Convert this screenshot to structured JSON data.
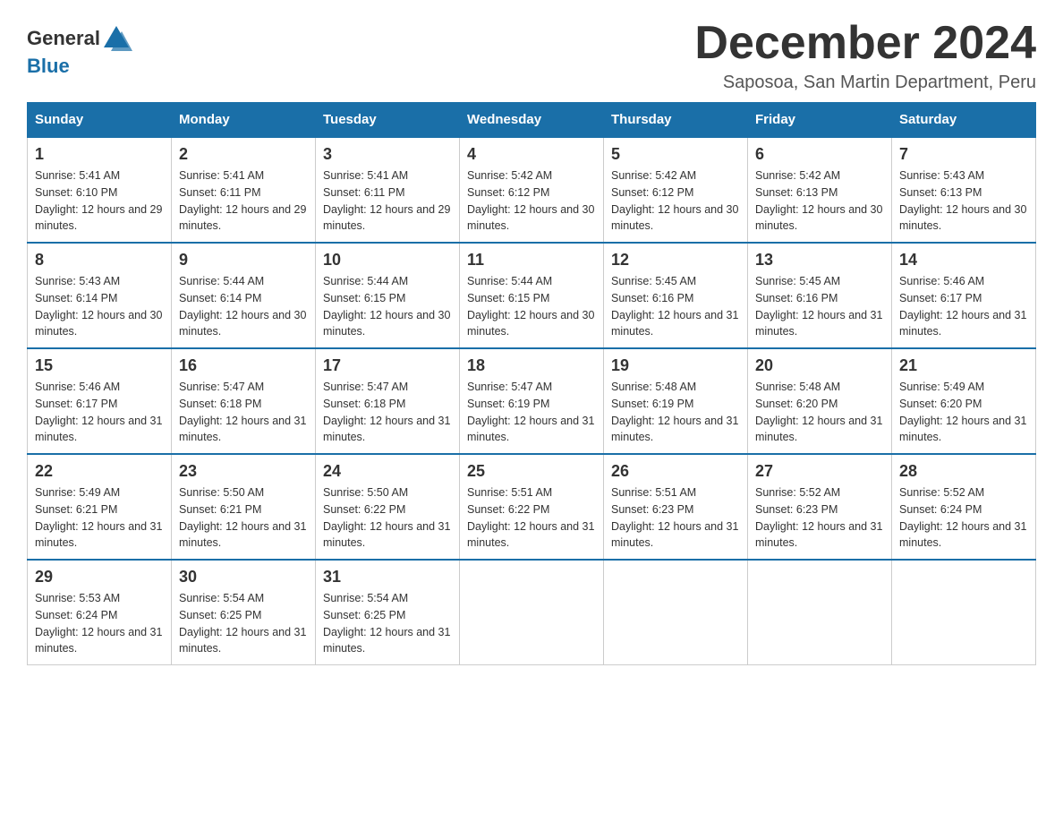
{
  "logo": {
    "general": "General",
    "blue": "Blue"
  },
  "title": "December 2024",
  "subtitle": "Saposoa, San Martin Department, Peru",
  "days": [
    "Sunday",
    "Monday",
    "Tuesday",
    "Wednesday",
    "Thursday",
    "Friday",
    "Saturday"
  ],
  "weeks": [
    [
      {
        "num": "1",
        "sunrise": "5:41 AM",
        "sunset": "6:10 PM",
        "daylight": "12 hours and 29 minutes."
      },
      {
        "num": "2",
        "sunrise": "5:41 AM",
        "sunset": "6:11 PM",
        "daylight": "12 hours and 29 minutes."
      },
      {
        "num": "3",
        "sunrise": "5:41 AM",
        "sunset": "6:11 PM",
        "daylight": "12 hours and 29 minutes."
      },
      {
        "num": "4",
        "sunrise": "5:42 AM",
        "sunset": "6:12 PM",
        "daylight": "12 hours and 30 minutes."
      },
      {
        "num": "5",
        "sunrise": "5:42 AM",
        "sunset": "6:12 PM",
        "daylight": "12 hours and 30 minutes."
      },
      {
        "num": "6",
        "sunrise": "5:42 AM",
        "sunset": "6:13 PM",
        "daylight": "12 hours and 30 minutes."
      },
      {
        "num": "7",
        "sunrise": "5:43 AM",
        "sunset": "6:13 PM",
        "daylight": "12 hours and 30 minutes."
      }
    ],
    [
      {
        "num": "8",
        "sunrise": "5:43 AM",
        "sunset": "6:14 PM",
        "daylight": "12 hours and 30 minutes."
      },
      {
        "num": "9",
        "sunrise": "5:44 AM",
        "sunset": "6:14 PM",
        "daylight": "12 hours and 30 minutes."
      },
      {
        "num": "10",
        "sunrise": "5:44 AM",
        "sunset": "6:15 PM",
        "daylight": "12 hours and 30 minutes."
      },
      {
        "num": "11",
        "sunrise": "5:44 AM",
        "sunset": "6:15 PM",
        "daylight": "12 hours and 30 minutes."
      },
      {
        "num": "12",
        "sunrise": "5:45 AM",
        "sunset": "6:16 PM",
        "daylight": "12 hours and 31 minutes."
      },
      {
        "num": "13",
        "sunrise": "5:45 AM",
        "sunset": "6:16 PM",
        "daylight": "12 hours and 31 minutes."
      },
      {
        "num": "14",
        "sunrise": "5:46 AM",
        "sunset": "6:17 PM",
        "daylight": "12 hours and 31 minutes."
      }
    ],
    [
      {
        "num": "15",
        "sunrise": "5:46 AM",
        "sunset": "6:17 PM",
        "daylight": "12 hours and 31 minutes."
      },
      {
        "num": "16",
        "sunrise": "5:47 AM",
        "sunset": "6:18 PM",
        "daylight": "12 hours and 31 minutes."
      },
      {
        "num": "17",
        "sunrise": "5:47 AM",
        "sunset": "6:18 PM",
        "daylight": "12 hours and 31 minutes."
      },
      {
        "num": "18",
        "sunrise": "5:47 AM",
        "sunset": "6:19 PM",
        "daylight": "12 hours and 31 minutes."
      },
      {
        "num": "19",
        "sunrise": "5:48 AM",
        "sunset": "6:19 PM",
        "daylight": "12 hours and 31 minutes."
      },
      {
        "num": "20",
        "sunrise": "5:48 AM",
        "sunset": "6:20 PM",
        "daylight": "12 hours and 31 minutes."
      },
      {
        "num": "21",
        "sunrise": "5:49 AM",
        "sunset": "6:20 PM",
        "daylight": "12 hours and 31 minutes."
      }
    ],
    [
      {
        "num": "22",
        "sunrise": "5:49 AM",
        "sunset": "6:21 PM",
        "daylight": "12 hours and 31 minutes."
      },
      {
        "num": "23",
        "sunrise": "5:50 AM",
        "sunset": "6:21 PM",
        "daylight": "12 hours and 31 minutes."
      },
      {
        "num": "24",
        "sunrise": "5:50 AM",
        "sunset": "6:22 PM",
        "daylight": "12 hours and 31 minutes."
      },
      {
        "num": "25",
        "sunrise": "5:51 AM",
        "sunset": "6:22 PM",
        "daylight": "12 hours and 31 minutes."
      },
      {
        "num": "26",
        "sunrise": "5:51 AM",
        "sunset": "6:23 PM",
        "daylight": "12 hours and 31 minutes."
      },
      {
        "num": "27",
        "sunrise": "5:52 AM",
        "sunset": "6:23 PM",
        "daylight": "12 hours and 31 minutes."
      },
      {
        "num": "28",
        "sunrise": "5:52 AM",
        "sunset": "6:24 PM",
        "daylight": "12 hours and 31 minutes."
      }
    ],
    [
      {
        "num": "29",
        "sunrise": "5:53 AM",
        "sunset": "6:24 PM",
        "daylight": "12 hours and 31 minutes."
      },
      {
        "num": "30",
        "sunrise": "5:54 AM",
        "sunset": "6:25 PM",
        "daylight": "12 hours and 31 minutes."
      },
      {
        "num": "31",
        "sunrise": "5:54 AM",
        "sunset": "6:25 PM",
        "daylight": "12 hours and 31 minutes."
      },
      null,
      null,
      null,
      null
    ]
  ]
}
